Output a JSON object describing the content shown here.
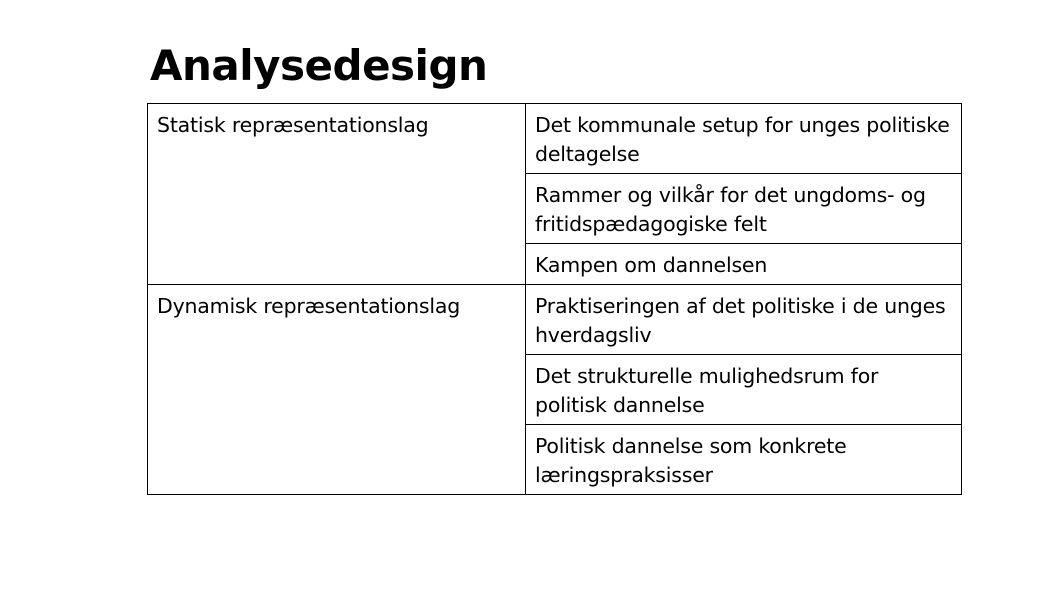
{
  "title": "Analysedesign",
  "table": {
    "groups": [
      {
        "label": "Statisk repræsentationslag",
        "items": [
          "Det kommunale setup for unges politiske deltagelse",
          "Rammer og vilkår for det ungdoms- og fritidspædagogiske felt",
          "Kampen om dannelsen"
        ]
      },
      {
        "label": "Dynamisk repræsentationslag",
        "items": [
          "Praktiseringen af det politiske i de unges hverdagsliv",
          "Det strukturelle mulighedsrum for politisk dannelse",
          "Politisk dannelse som konkrete læringspraksisser"
        ]
      }
    ]
  }
}
